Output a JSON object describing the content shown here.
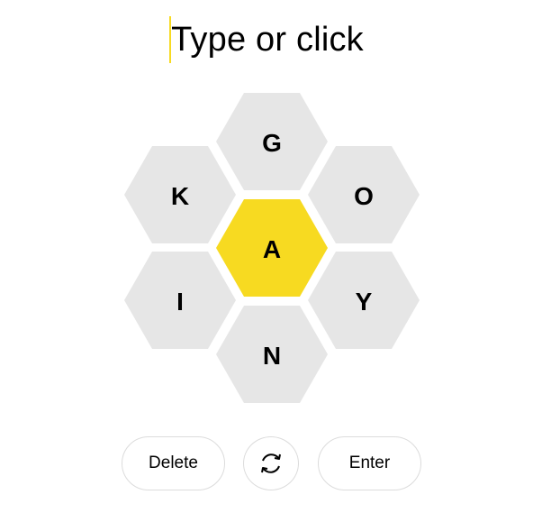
{
  "input": {
    "placeholder": "Type or click"
  },
  "hive": {
    "center_letter": "A",
    "outer_letters": [
      "G",
      "O",
      "Y",
      "N",
      "I",
      "K"
    ],
    "colors": {
      "center": "#f7da21",
      "outer": "#e6e6e6",
      "caret": "#f7da21"
    }
  },
  "controls": {
    "delete_label": "Delete",
    "shuffle_icon": "shuffle-icon",
    "enter_label": "Enter"
  }
}
